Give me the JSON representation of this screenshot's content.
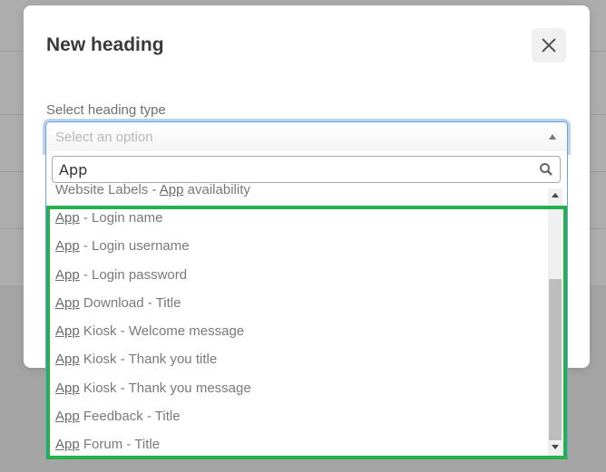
{
  "modal": {
    "title": "New heading",
    "close_icon": "close-icon"
  },
  "form": {
    "field_label": "Select heading type",
    "select": {
      "placeholder": "Select an option",
      "arrow_icon": "chevron-up-icon"
    },
    "search": {
      "value": "App",
      "icon": "search-icon"
    },
    "options": [
      {
        "prefix": "Website Labels - ",
        "match": "App",
        "suffix": " availability",
        "clipped": true
      },
      {
        "prefix": "",
        "match": "App",
        "suffix": " - Login name"
      },
      {
        "prefix": "",
        "match": "App",
        "suffix": " - Login username"
      },
      {
        "prefix": "",
        "match": "App",
        "suffix": " - Login password"
      },
      {
        "prefix": "",
        "match": "App",
        "suffix": " Download - Title"
      },
      {
        "prefix": "",
        "match": "App",
        "suffix": " Kiosk - Welcome message"
      },
      {
        "prefix": "",
        "match": "App",
        "suffix": " Kiosk - Thank you title"
      },
      {
        "prefix": "",
        "match": "App",
        "suffix": " Kiosk - Thank you message"
      },
      {
        "prefix": "",
        "match": "App",
        "suffix": " Feedback - Title"
      },
      {
        "prefix": "",
        "match": "App",
        "suffix": " Forum - Title"
      }
    ]
  },
  "colors": {
    "highlight": "#24b04b",
    "focus": "#6aa1e0"
  }
}
